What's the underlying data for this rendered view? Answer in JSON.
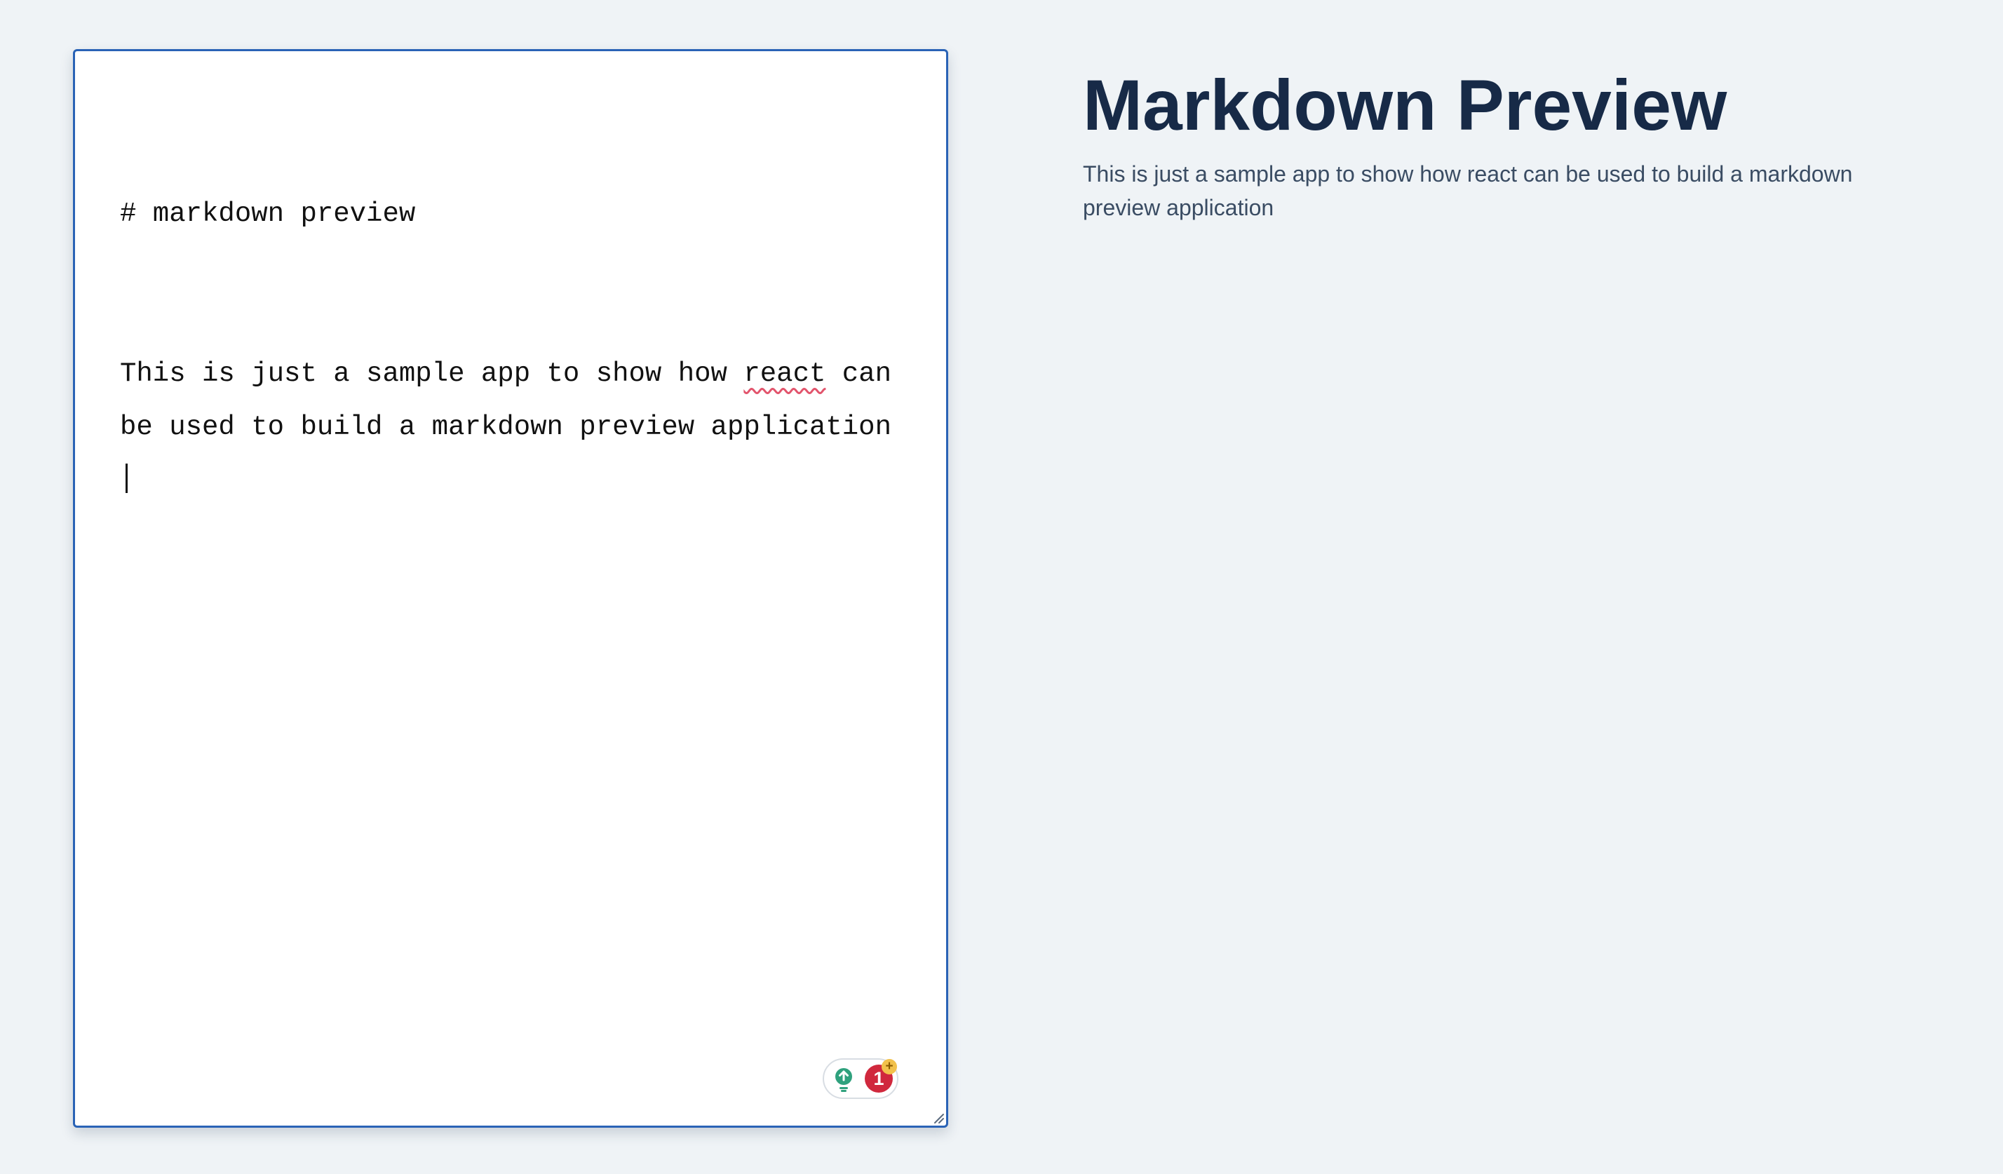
{
  "editor": {
    "heading_line": "# markdown preview",
    "body_before": "This is just a sample app to show how ",
    "misspelled_word": "react",
    "body_after": " can be used to build a markdown preview application"
  },
  "grammar_widget": {
    "error_count": "1",
    "plus_label": "+",
    "bulb_icon": "lightbulb-icon",
    "bulb_color": "#2fa17d",
    "badge_color": "#d0283d"
  },
  "preview": {
    "title": "Markdown Preview",
    "paragraph": "This is just a sample app to show how react can be used to build a markdown preview application"
  },
  "colors": {
    "background": "#eff3f6",
    "editor_border": "#2a63b6",
    "title_color": "#172a47",
    "spellcheck_underline": "#e2546c"
  }
}
